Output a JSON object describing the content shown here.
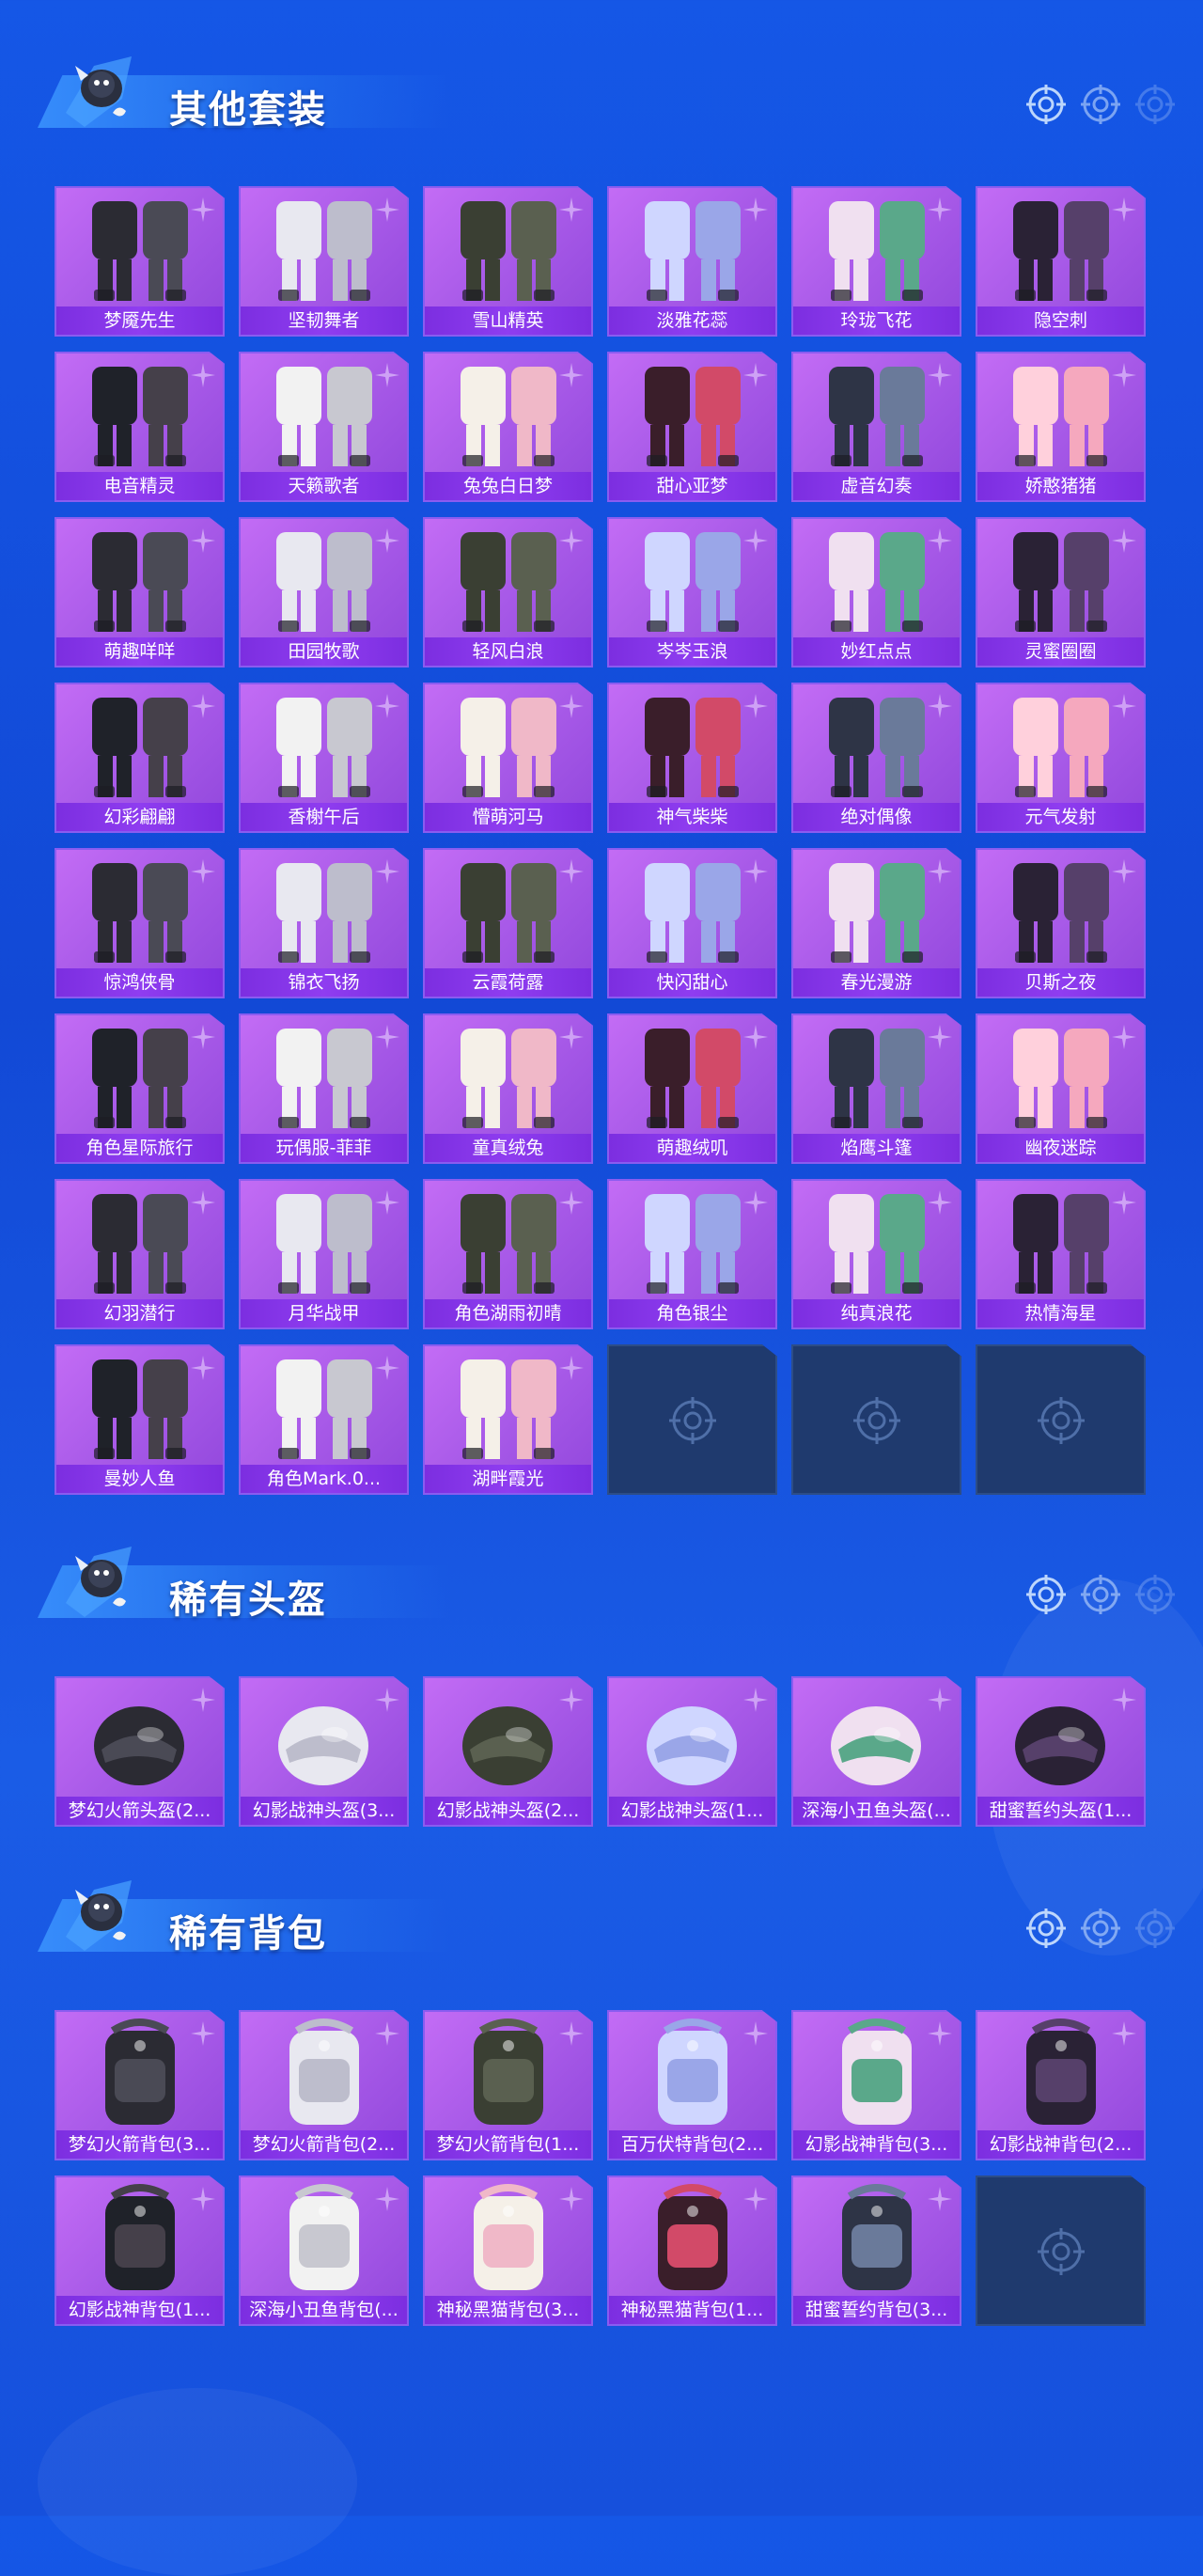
{
  "sections": [
    {
      "title": "其他套装",
      "items": [
        "梦魇先生",
        "坚韧舞者",
        "雪山精英",
        "淡雅花蕊",
        "玲珑飞花",
        "隐空刺",
        "电音精灵",
        "天籁歌者",
        "兔兔白日梦",
        "甜心亚梦",
        "虚音幻奏",
        "娇憨猪猪",
        "萌趣咩咩",
        "田园牧歌",
        "轻风白浪",
        "岑岑玉浪",
        "妙红点点",
        "灵蜜圈圈",
        "幻彩翩翩",
        "香榭午后",
        "懵萌河马",
        "神气柴柴",
        "绝对偶像",
        "元气发射",
        "惊鸿侠骨",
        "锦衣飞扬",
        "云霞荷露",
        "快闪甜心",
        "春光漫游",
        "贝斯之夜",
        "角色星际旅行",
        "玩偶服-菲菲",
        "童真绒兔",
        "萌趣绒叽",
        "焰鹰斗篷",
        "幽夜迷踪",
        "幻羽潜行",
        "月华战甲",
        "角色湖雨初晴",
        "角色银尘",
        "纯真浪花",
        "热情海星",
        "曼妙人鱼",
        "角色Mark.0...",
        "湖畔霞光"
      ],
      "empty_slots": 3
    },
    {
      "title": "稀有头盔",
      "items": [
        "梦幻火箭头盔(2...",
        "幻影战神头盔(3...",
        "幻影战神头盔(2...",
        "幻影战神头盔(1...",
        "深海小丑鱼头盔(...",
        "甜蜜誓约头盔(1..."
      ],
      "empty_slots": 0
    },
    {
      "title": "稀有背包",
      "items": [
        "梦幻火箭背包(3...",
        "梦幻火箭背包(2...",
        "梦幻火箭背包(1...",
        "百万伏特背包(2...",
        "幻影战神背包(3...",
        "幻影战神背包(2...",
        "幻影战神背包(1...",
        "深海小丑鱼背包(...",
        "神秘黑猫背包(3...",
        "神秘黑猫背包(1...",
        "甜蜜誓约背包(3..."
      ],
      "empty_slots": 1
    }
  ],
  "colors": {
    "background": "#1557e6",
    "card": "#b063ee",
    "label_bar": "#8f3df0",
    "empty_card": "#1f3a6e"
  }
}
